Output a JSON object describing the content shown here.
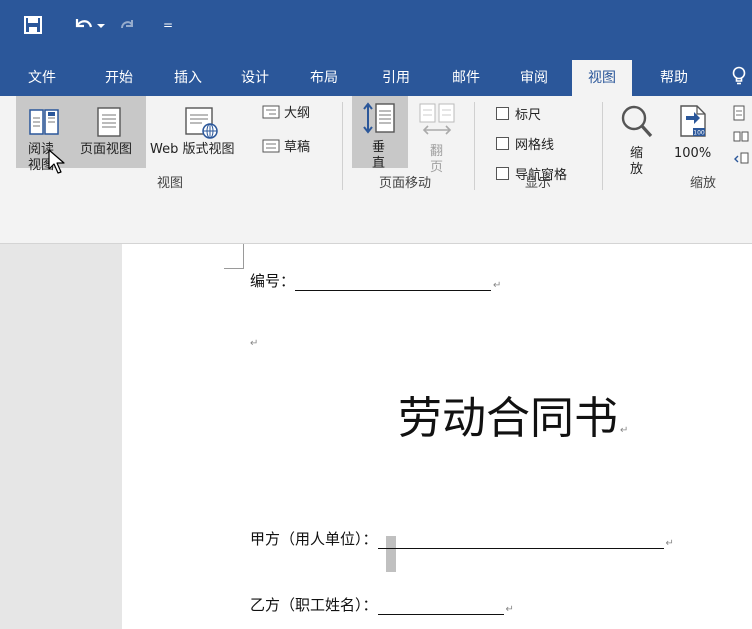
{
  "qat": {
    "more": "="
  },
  "tabs": [
    {
      "label": "文件",
      "left": 0
    },
    {
      "label": "开始"
    },
    {
      "label": "插入"
    },
    {
      "label": "设计"
    },
    {
      "label": "布局"
    },
    {
      "label": "引用"
    },
    {
      "label": "邮件"
    },
    {
      "label": "审阅"
    },
    {
      "label": "视图"
    },
    {
      "label": "帮助"
    }
  ],
  "ribbon": {
    "views": {
      "read_mode_1": "阅读",
      "read_mode_2": "视图",
      "print_layout": "页面视图",
      "web_layout": "Web 版式视图",
      "outline": "大纲",
      "draft": "草稿",
      "group_label": "视图"
    },
    "page_movement": {
      "vertical_1": "垂",
      "vertical_2": "直",
      "side_1": "翻",
      "side_2": "页",
      "group_label": "页面移动"
    },
    "show": {
      "ruler": "标尺",
      "gridlines": "网格线",
      "nav_pane": "导航窗格",
      "group_label": "显示"
    },
    "zoom": {
      "zoom_1": "缩",
      "zoom_2": "放",
      "hundred": "100%",
      "group_label": "缩放"
    }
  },
  "document": {
    "number_label": "编号：",
    "title": "劳动合同书",
    "party_a": "甲方（用人单位）：",
    "party_b": "乙方（职工姓名）："
  },
  "colors": {
    "brand": "#2b579a",
    "ribbon_bg": "#f3f3f3",
    "highlight": "#c8c8c8"
  }
}
